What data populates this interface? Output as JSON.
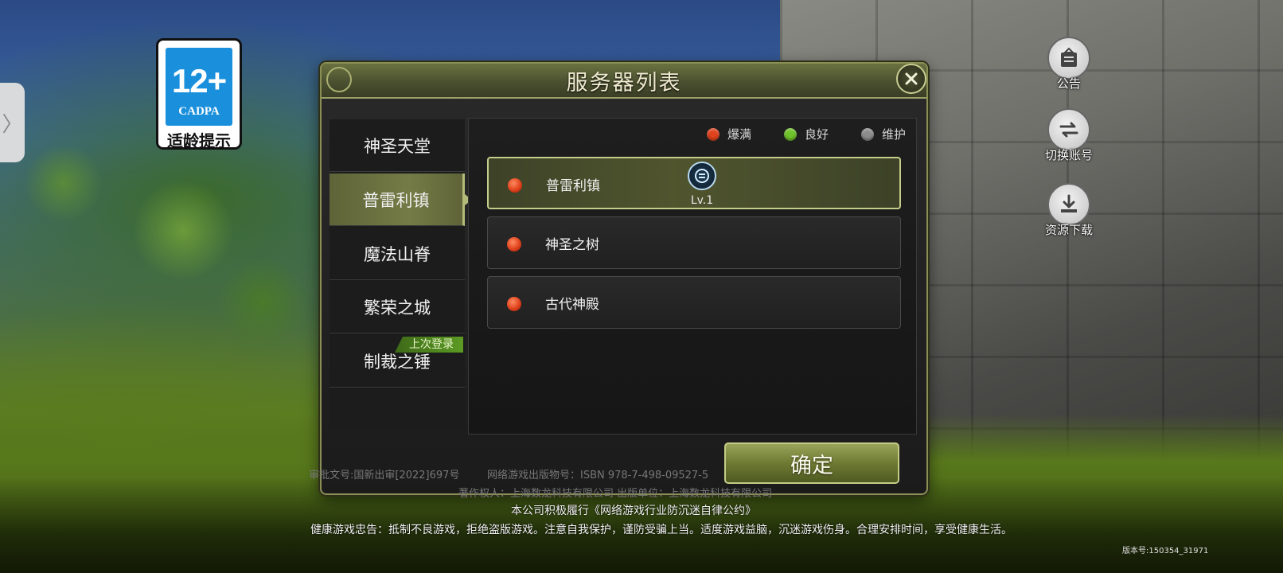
{
  "age_rating": {
    "number": "12+",
    "org": "CADPA",
    "tip": "适龄提示"
  },
  "side_tab": {
    "glyph": "〉"
  },
  "right_buttons": {
    "notice": {
      "label": "公告",
      "icon": "notice-board-icon"
    },
    "switch_account": {
      "label": "切换账号",
      "icon": "swap-arrows-icon"
    },
    "download": {
      "label": "资源下载",
      "icon": "download-icon"
    }
  },
  "panel": {
    "title": "服务器列表",
    "close_icon": "close-icon",
    "categories": [
      {
        "label": "神圣天堂"
      },
      {
        "label": "普雷利镇"
      },
      {
        "label": "魔法山脊"
      },
      {
        "label": "繁荣之城"
      },
      {
        "label": "制裁之锤"
      }
    ],
    "active_category_index": 1,
    "last_login_badge": "上次登录",
    "legend": [
      {
        "label": "爆满",
        "color": "#e0421c"
      },
      {
        "label": "良好",
        "color": "#6fc22a"
      },
      {
        "label": "维护",
        "color": "#8c8c8c"
      }
    ],
    "servers": [
      {
        "name": "普雷利镇",
        "status": "爆满",
        "selected": true,
        "role_level": "Lv.1"
      },
      {
        "name": "神圣之树",
        "status": "爆满",
        "selected": false
      },
      {
        "name": "古代神殿",
        "status": "爆满",
        "selected": false
      }
    ],
    "confirm_label": "确定"
  },
  "footer": {
    "approval": "审批文号:国新出审[2022]697号",
    "isbn": "网络游戏出版物号：ISBN 978-7-498-09527-5",
    "copyright": "著作权人：上海数龙科技有限公司  出版单位：上海数龙科技有限公司",
    "pledge": "本公司积极履行《网络游戏行业防沉迷自律公约》",
    "health": "健康游戏忠告：抵制不良游戏，拒绝盗版游戏。注意自我保护，谨防受骗上当。适度游戏益脑，沉迷游戏伤身。合理安排时间，享受健康生活。",
    "version": "版本号:150354_31971"
  },
  "colors": {
    "accent_olive": "#747b46",
    "border_olive": "#c6cc8a",
    "status_full": "#e0421c",
    "status_good": "#6fc22a",
    "status_maintenance": "#8c8c8c"
  }
}
